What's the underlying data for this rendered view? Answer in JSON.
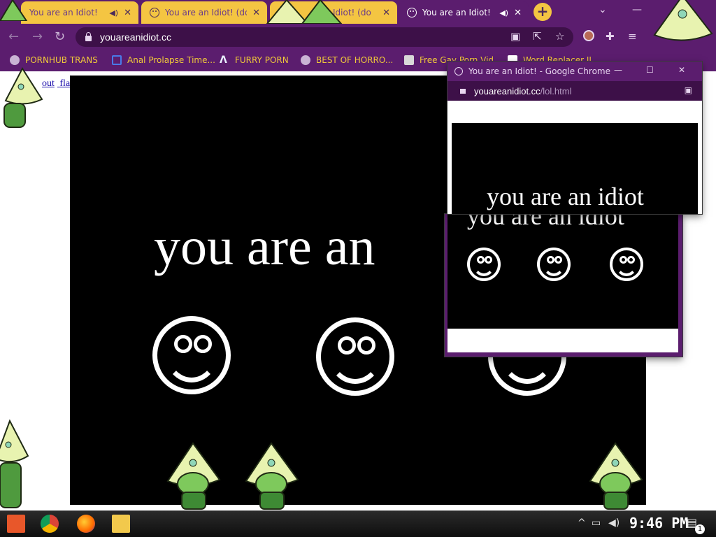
{
  "tabs": [
    {
      "title": "You are an Idiot!",
      "muted_icon": "speaker-icon"
    },
    {
      "title": "You are an Idiot! (do",
      "muted_icon": "none"
    },
    {
      "title": "Idiot! (do",
      "muted_icon": "none"
    },
    {
      "title": "You are an Idiot!",
      "muted_icon": "speaker-icon"
    }
  ],
  "omnibox": {
    "url": "youareanidiot.cc"
  },
  "bookmarks": [
    "PORNHUB TRANS",
    "Anal Prolapse Time...",
    "FURRY PORN",
    "BEST OF HORRO...",
    "Free Gay Porn Vid...",
    "Word Replacer II"
  ],
  "page": {
    "flash_link": [
      "out",
      "flash"
    ],
    "big_text": "you are an"
  },
  "popup": {
    "title": "You are an Idiot! - Google Chrome",
    "url_host": "youareanidiot.cc",
    "url_path": "/lol.html",
    "text_a": "you are an idiot",
    "text_b": "you are an idiot"
  },
  "taskbar": {
    "clock": "9:46 PM",
    "notification_count": "1"
  },
  "colors": {
    "chrome_purple": "#5b1d6e",
    "tab_yellow": "#f4c542",
    "bookmark_text": "#f0c93a",
    "stage": "#000000"
  }
}
